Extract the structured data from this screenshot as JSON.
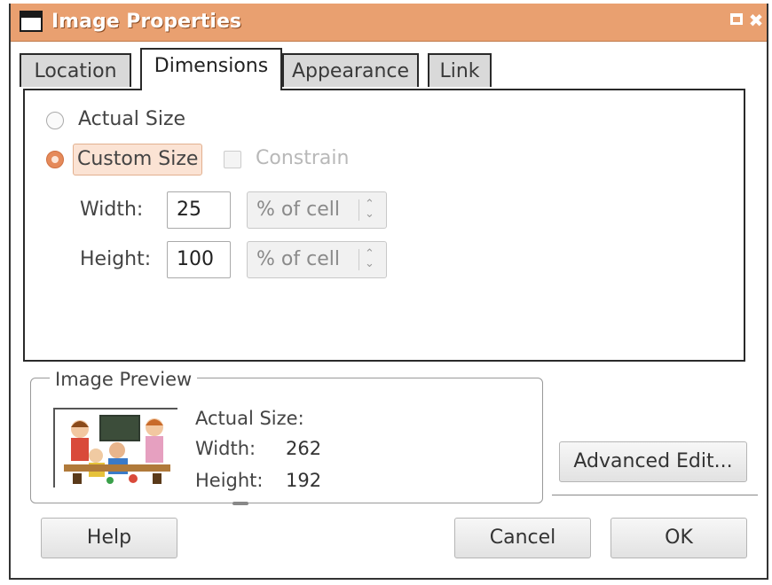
{
  "window": {
    "title": "Image Properties"
  },
  "tabs": [
    {
      "label": "Location",
      "active": false
    },
    {
      "label": "Dimensions",
      "active": true
    },
    {
      "label": "Appearance",
      "active": false
    },
    {
      "label": "Link",
      "active": false
    }
  ],
  "dimensions": {
    "actual_size_label": "Actual Size",
    "custom_size_label": "Custom Size",
    "constrain_label": "Constrain",
    "selected": "custom",
    "constrain_checked": false,
    "width_label": "Width:",
    "width_value": "25",
    "width_unit": "% of cell",
    "height_label": "Height:",
    "height_value": "100",
    "height_unit": "% of cell"
  },
  "preview": {
    "group_title": "Image Preview",
    "actual_size_heading": "Actual Size:",
    "width_label": "Width:",
    "width_value": "262",
    "height_label": "Height:",
    "height_value": "192"
  },
  "buttons": {
    "advanced_edit": "Advanced Edit...",
    "help": "Help",
    "cancel": "Cancel",
    "ok": "OK"
  },
  "colors": {
    "titlebar": "#e9a070",
    "radio_selected": "#e58a5a",
    "selection_bg": "#fbe3d4"
  },
  "icons": [
    "window-icon",
    "maximize-icon",
    "close-icon",
    "spin-arrows-icon"
  ]
}
